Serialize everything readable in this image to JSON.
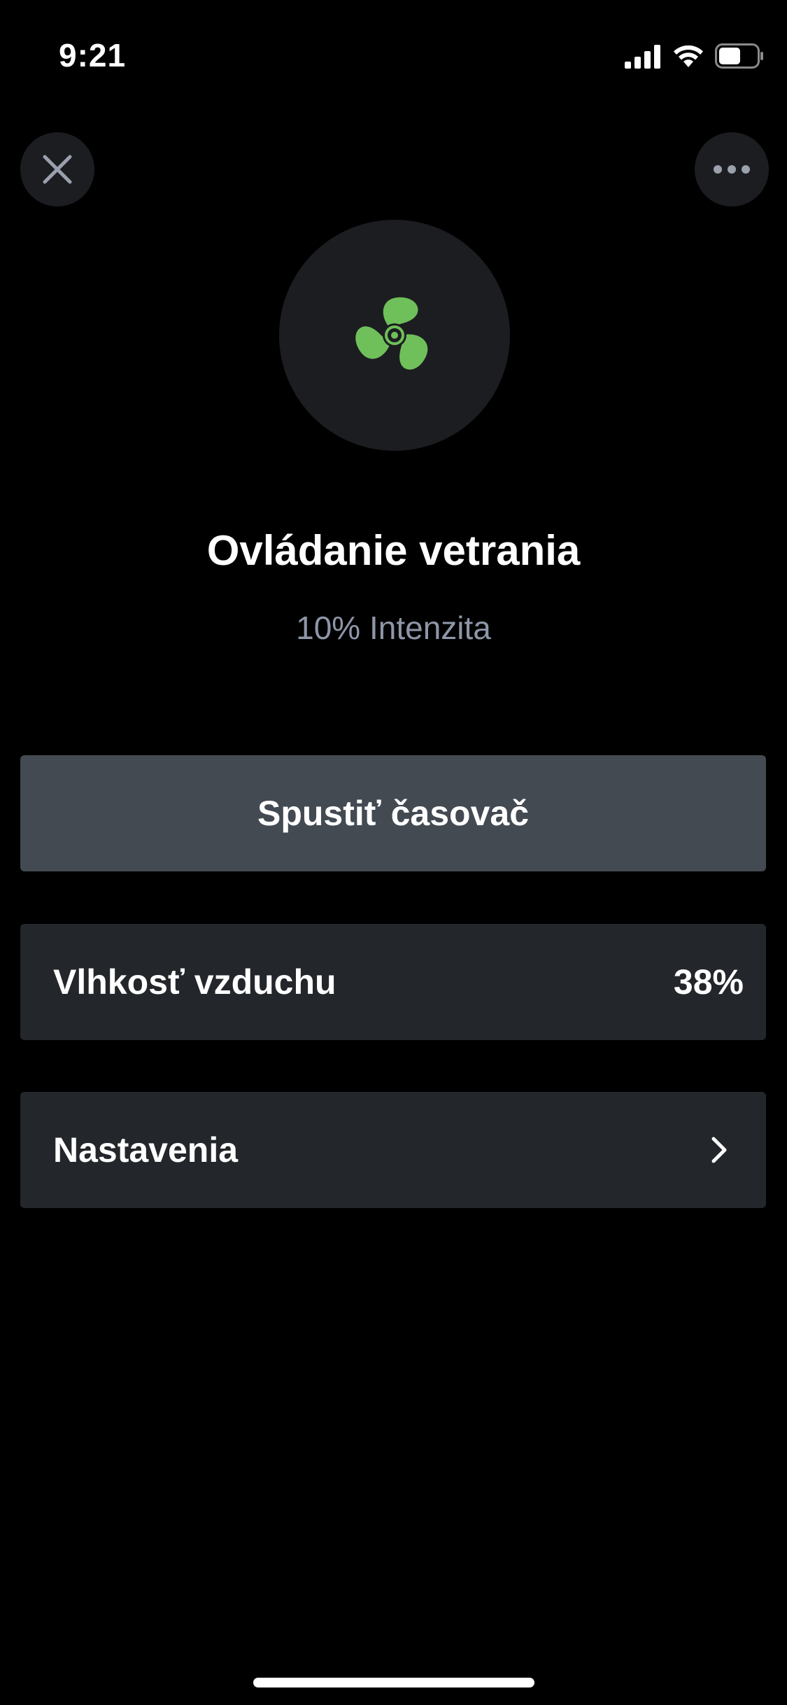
{
  "status_bar": {
    "time": "9:21"
  },
  "header": {
    "close_icon": "close-icon",
    "more_icon": "more-horizontal-icon"
  },
  "device": {
    "icon": "fan-icon",
    "icon_color": "#6fbf5a",
    "title": "Ovládanie vetrania",
    "subtitle": "10% Intenzita"
  },
  "actions": {
    "timer_label": "Spustiť časovač"
  },
  "rows": {
    "humidity_label": "Vlhkosť vzduchu",
    "humidity_value": "38%",
    "settings_label": "Nastavenia"
  },
  "colors": {
    "background": "#000000",
    "card": "#23262a",
    "button": "#444a52",
    "subtitle": "#8e96a8",
    "accent": "#6fbf5a"
  }
}
